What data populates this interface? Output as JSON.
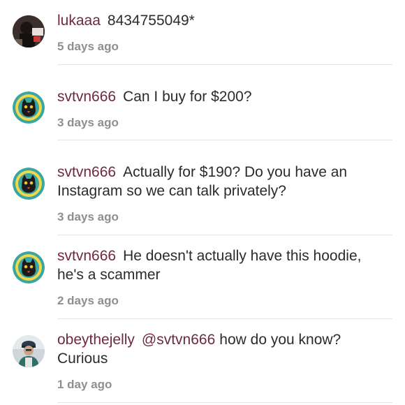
{
  "comments": [
    {
      "username": "lukaaa",
      "text": "8434755049*",
      "time": "5 days ago",
      "avatar_icon": "user-photo-dark-icon"
    },
    {
      "username": "svtvn666",
      "text": "Can I buy for $200?",
      "time": "3 days ago",
      "avatar_icon": "cat-badge-icon"
    },
    {
      "username": "svtvn666",
      "text": "Actually for $190? Do you have an Instagram so we can talk privately?",
      "time": "3 days ago",
      "avatar_icon": "cat-badge-icon"
    },
    {
      "username": "svtvn666",
      "text": "He doesn't actually have this hoodie, he's a scammer",
      "time": "2 days ago",
      "avatar_icon": "cat-badge-icon"
    },
    {
      "username": "obeythejelly",
      "mention": "@svtvn666",
      "text": "how do you know? Curious",
      "time": "1 day ago",
      "avatar_icon": "user-photo-cap-icon"
    }
  ],
  "colors": {
    "username": "#6e2a3c",
    "text": "#2b2b2b",
    "meta": "#8f8f8f",
    "divider": "#e3e3e3"
  }
}
